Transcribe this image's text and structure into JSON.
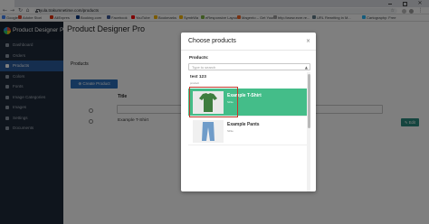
{
  "browser": {
    "url": "yula.trakumnetime.com/products",
    "bookmarks": [
      "Google",
      "Adobe Stori",
      "AliExpres",
      "Booking.com",
      "Facebook",
      "YouTube",
      "Bookmarks",
      "SymbWa",
      "eResponsive Layou",
      "Magento – Get Your...",
      "http://www.ecre.re...",
      "URL Rewriting in M...",
      "Cartography: Free"
    ]
  },
  "sidebar": {
    "brand": "Product Designer Pro",
    "items": [
      {
        "label": "Dashboard",
        "active": false
      },
      {
        "label": "Orders",
        "active": false
      },
      {
        "label": "Products",
        "active": true
      },
      {
        "label": "Colors",
        "active": false
      },
      {
        "label": "Fonts",
        "active": false
      },
      {
        "label": "Image Categories",
        "active": false
      },
      {
        "label": "Images",
        "active": false
      },
      {
        "label": "Settings",
        "active": false
      },
      {
        "label": "Documents",
        "active": false
      }
    ]
  },
  "main": {
    "title": "Product Designer Pro",
    "section": "Products",
    "create_button": "Create Product",
    "column_title": "Title",
    "rows": [
      {
        "name": "Example T-Shirt",
        "edit": "Edit"
      }
    ]
  },
  "modal": {
    "title": "Choose products",
    "close": "×",
    "field_label": "Products:",
    "search_placeholder": "Type to search",
    "results": [
      {
        "name": "test 123",
        "sub": "product",
        "thumb": "none",
        "selected": false
      },
      {
        "name": "Example T-Shirt",
        "sub": "Slrtie",
        "thumb": "tshirt",
        "selected": true
      },
      {
        "name": "Example Pants",
        "sub": "Slrtie",
        "thumb": "pants",
        "selected": false
      }
    ]
  },
  "colors": {
    "sidebar_bg": "#1e2a3a",
    "sidebar_active": "#2a5c9e",
    "primary_button": "#2a6ebb",
    "selected_result": "#44bd89",
    "edit_button": "#2b8a7e",
    "highlight_border": "#c0392b"
  }
}
